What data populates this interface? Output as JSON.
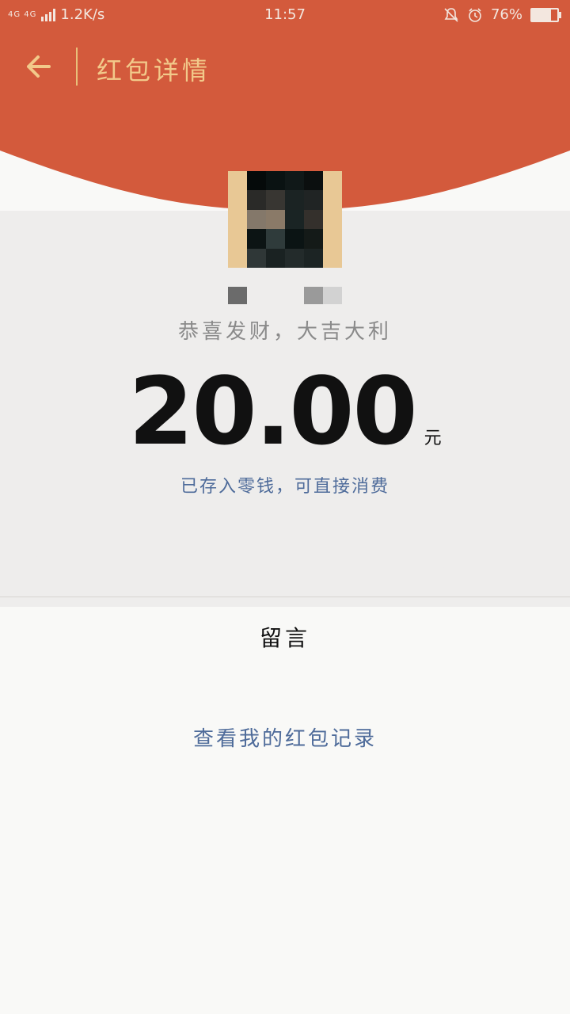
{
  "status_bar": {
    "network": "4G 4G",
    "speed": "1.2K/s",
    "time": "11:57",
    "battery": "76%",
    "battery_level": 0.76,
    "icons": [
      "silent-bell-icon",
      "alarm-icon",
      "battery-icon"
    ]
  },
  "header": {
    "title": "红包详情",
    "back_icon": "back-arrow-icon"
  },
  "envelope": {
    "greeting": "恭喜发财，大吉大利",
    "amount": "20.00",
    "unit": "元",
    "storage_note": "已存入零钱，可直接消费"
  },
  "message": {
    "title": "留言"
  },
  "records": {
    "link": "查看我的红包记录"
  },
  "colors": {
    "header_red": "#d35a3c",
    "title_gold": "#f2c98a",
    "link_blue": "#4e6b9a",
    "background": "#eeedec"
  }
}
